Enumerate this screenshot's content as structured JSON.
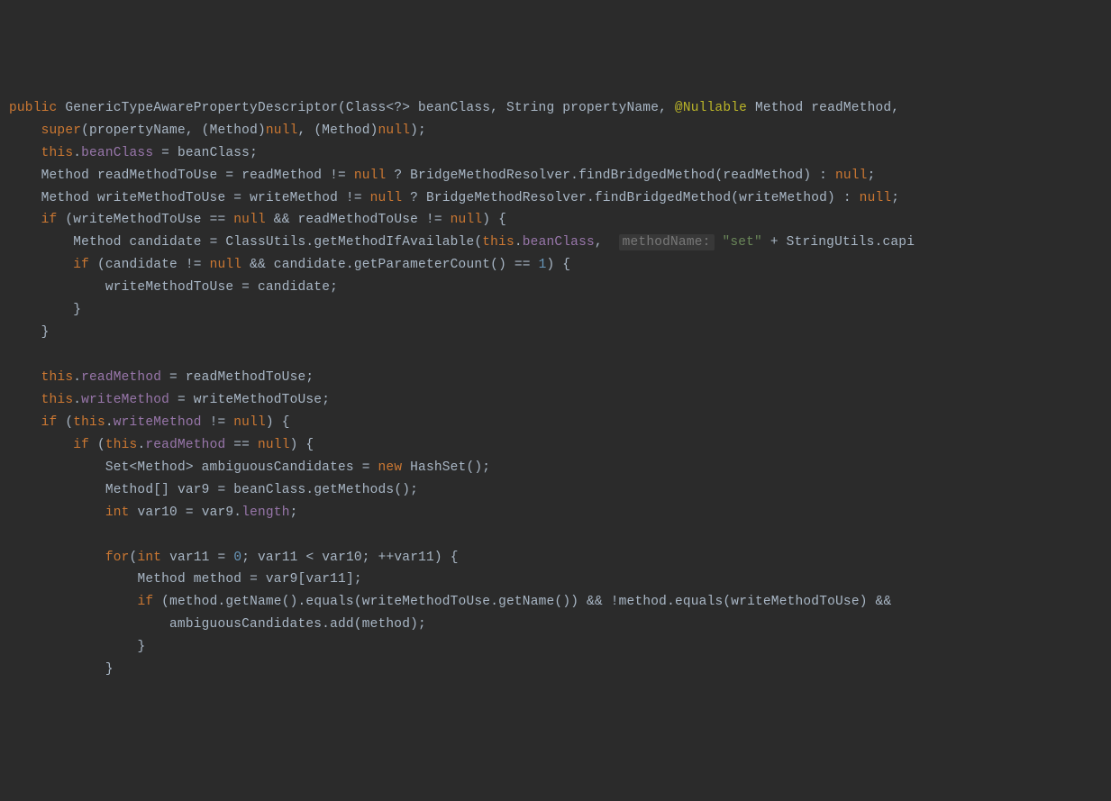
{
  "tokens": {
    "kw_public": "public",
    "class_gtapd": "GenericTypeAwarePropertyDescriptor",
    "type_classq": "Class<?>",
    "param_beanClass": "beanClass",
    "type_string": "String",
    "param_propertyName": "propertyName",
    "ann_nullable": "@Nullable",
    "type_method": "Method",
    "param_readMethod": "readMethod",
    "kw_super": "super",
    "cast_method": "(Method)",
    "kw_null": "null",
    "kw_this": "this",
    "field_beanClass": "beanClass",
    "type_method2": "Method",
    "var_readMethodToUse": "readMethodToUse",
    "cls_bridge": "BridgeMethodResolver",
    "m_findBridged": "findBridgedMethod",
    "var_writeMethodToUse": "writeMethodToUse",
    "param_writeMethod": "writeMethod",
    "kw_if": "if",
    "var_candidate": "candidate",
    "cls_classutils": "ClassUtils",
    "m_getMethodIfAvailable": "getMethodIfAvailable",
    "hint_methodName": "methodName:",
    "str_set": "\"set\"",
    "cls_stringutils": "StringUtils",
    "m_capi": "capi",
    "m_getParameterCount": "getParameterCount",
    "num_1": "1",
    "field_readMethod": "readMethod",
    "field_writeMethod": "writeMethod",
    "type_setmethod": "Set<Method>",
    "var_ambiguous": "ambiguousCandidates",
    "kw_new": "new",
    "cls_hashset": "HashSet",
    "type_methodarr": "Method[]",
    "var_var9": "var9",
    "m_getMethods": "getMethods",
    "kw_int": "int",
    "var_var10": "var10",
    "field_length": "length",
    "kw_for": "for",
    "var_var11": "var11",
    "num_0": "0",
    "var_method": "method",
    "m_getName": "getName",
    "m_equals": "equals",
    "m_add": "add",
    "op_eq": " = ",
    "op_ne": " != ",
    "op_eqeq": " == ",
    "op_and": " && ",
    "op_plus": " + ",
    "op_lt": " < ",
    "op_inc": "++",
    "op_not": "!",
    "op_tern_q": " ? ",
    "op_tern_c": " : ",
    "op_dot": ".",
    "p_open": "(",
    "p_close": ")",
    "b_open": "{",
    "b_close": "}",
    "sq_open": "[",
    "sq_close": "]",
    "semi": ";",
    "comma": ", ",
    "comma2": ",",
    "sp": " "
  }
}
